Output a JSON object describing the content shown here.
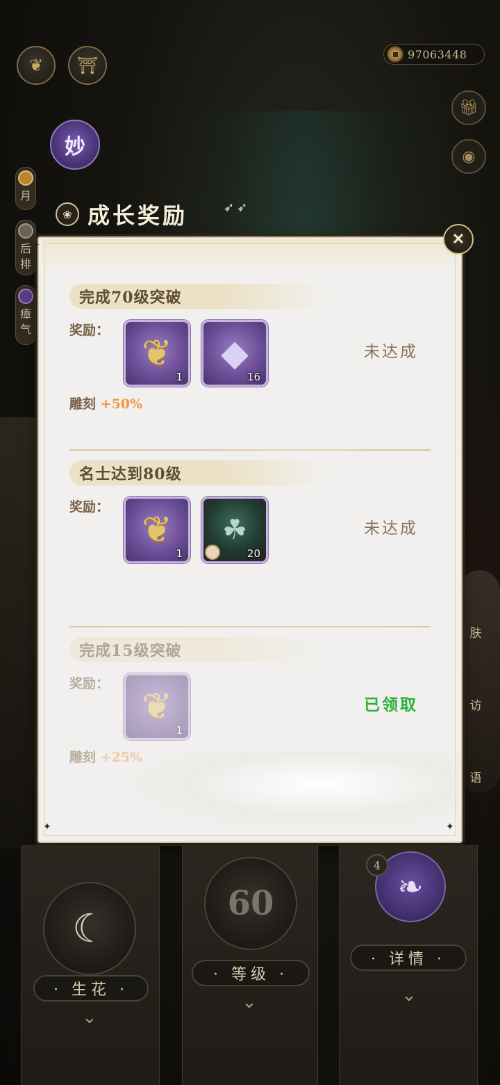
{
  "top": {
    "currency_value": "97063448"
  },
  "badge": {
    "label": "妙"
  },
  "side_tabs": [
    {
      "label": "月"
    },
    {
      "label": "后排"
    },
    {
      "label": "瘴气"
    }
  ],
  "right_side_labels": [
    "肤",
    "访",
    "语"
  ],
  "modal": {
    "title": "成长奖励",
    "close_label": "✕",
    "sections": [
      {
        "title": "完成70级突破",
        "reward_label": "奖励：",
        "items": [
          {
            "icon": "golden-pendant-icon",
            "qty": "1"
          },
          {
            "icon": "purple-crystal-icon",
            "qty": "16"
          }
        ],
        "status": "未达成",
        "bonus_label": "雕刻",
        "bonus_value": "+50%"
      },
      {
        "title": "名士达到80级",
        "reward_label": "奖励：",
        "items": [
          {
            "icon": "golden-pendant-icon",
            "qty": "1"
          },
          {
            "icon": "character-shard-icon",
            "qty": "20"
          }
        ],
        "status": "未达成"
      },
      {
        "title": "完成15级突破",
        "reward_label": "奖励：",
        "items": [
          {
            "icon": "golden-pendant-icon",
            "qty": "1"
          }
        ],
        "status": "已领取",
        "bonus_label": "雕刻",
        "bonus_value": "+25%"
      }
    ]
  },
  "bottom": {
    "bloom_label": "· 生花 ·",
    "level_value": "60",
    "level_label": "· 等级 ·",
    "detail_badge": "4",
    "detail_label": "· 详情 ·"
  },
  "colors": {
    "claimed": "#2fae3c",
    "bonus": "#f0963a",
    "item_purple": "#6c4f97"
  }
}
